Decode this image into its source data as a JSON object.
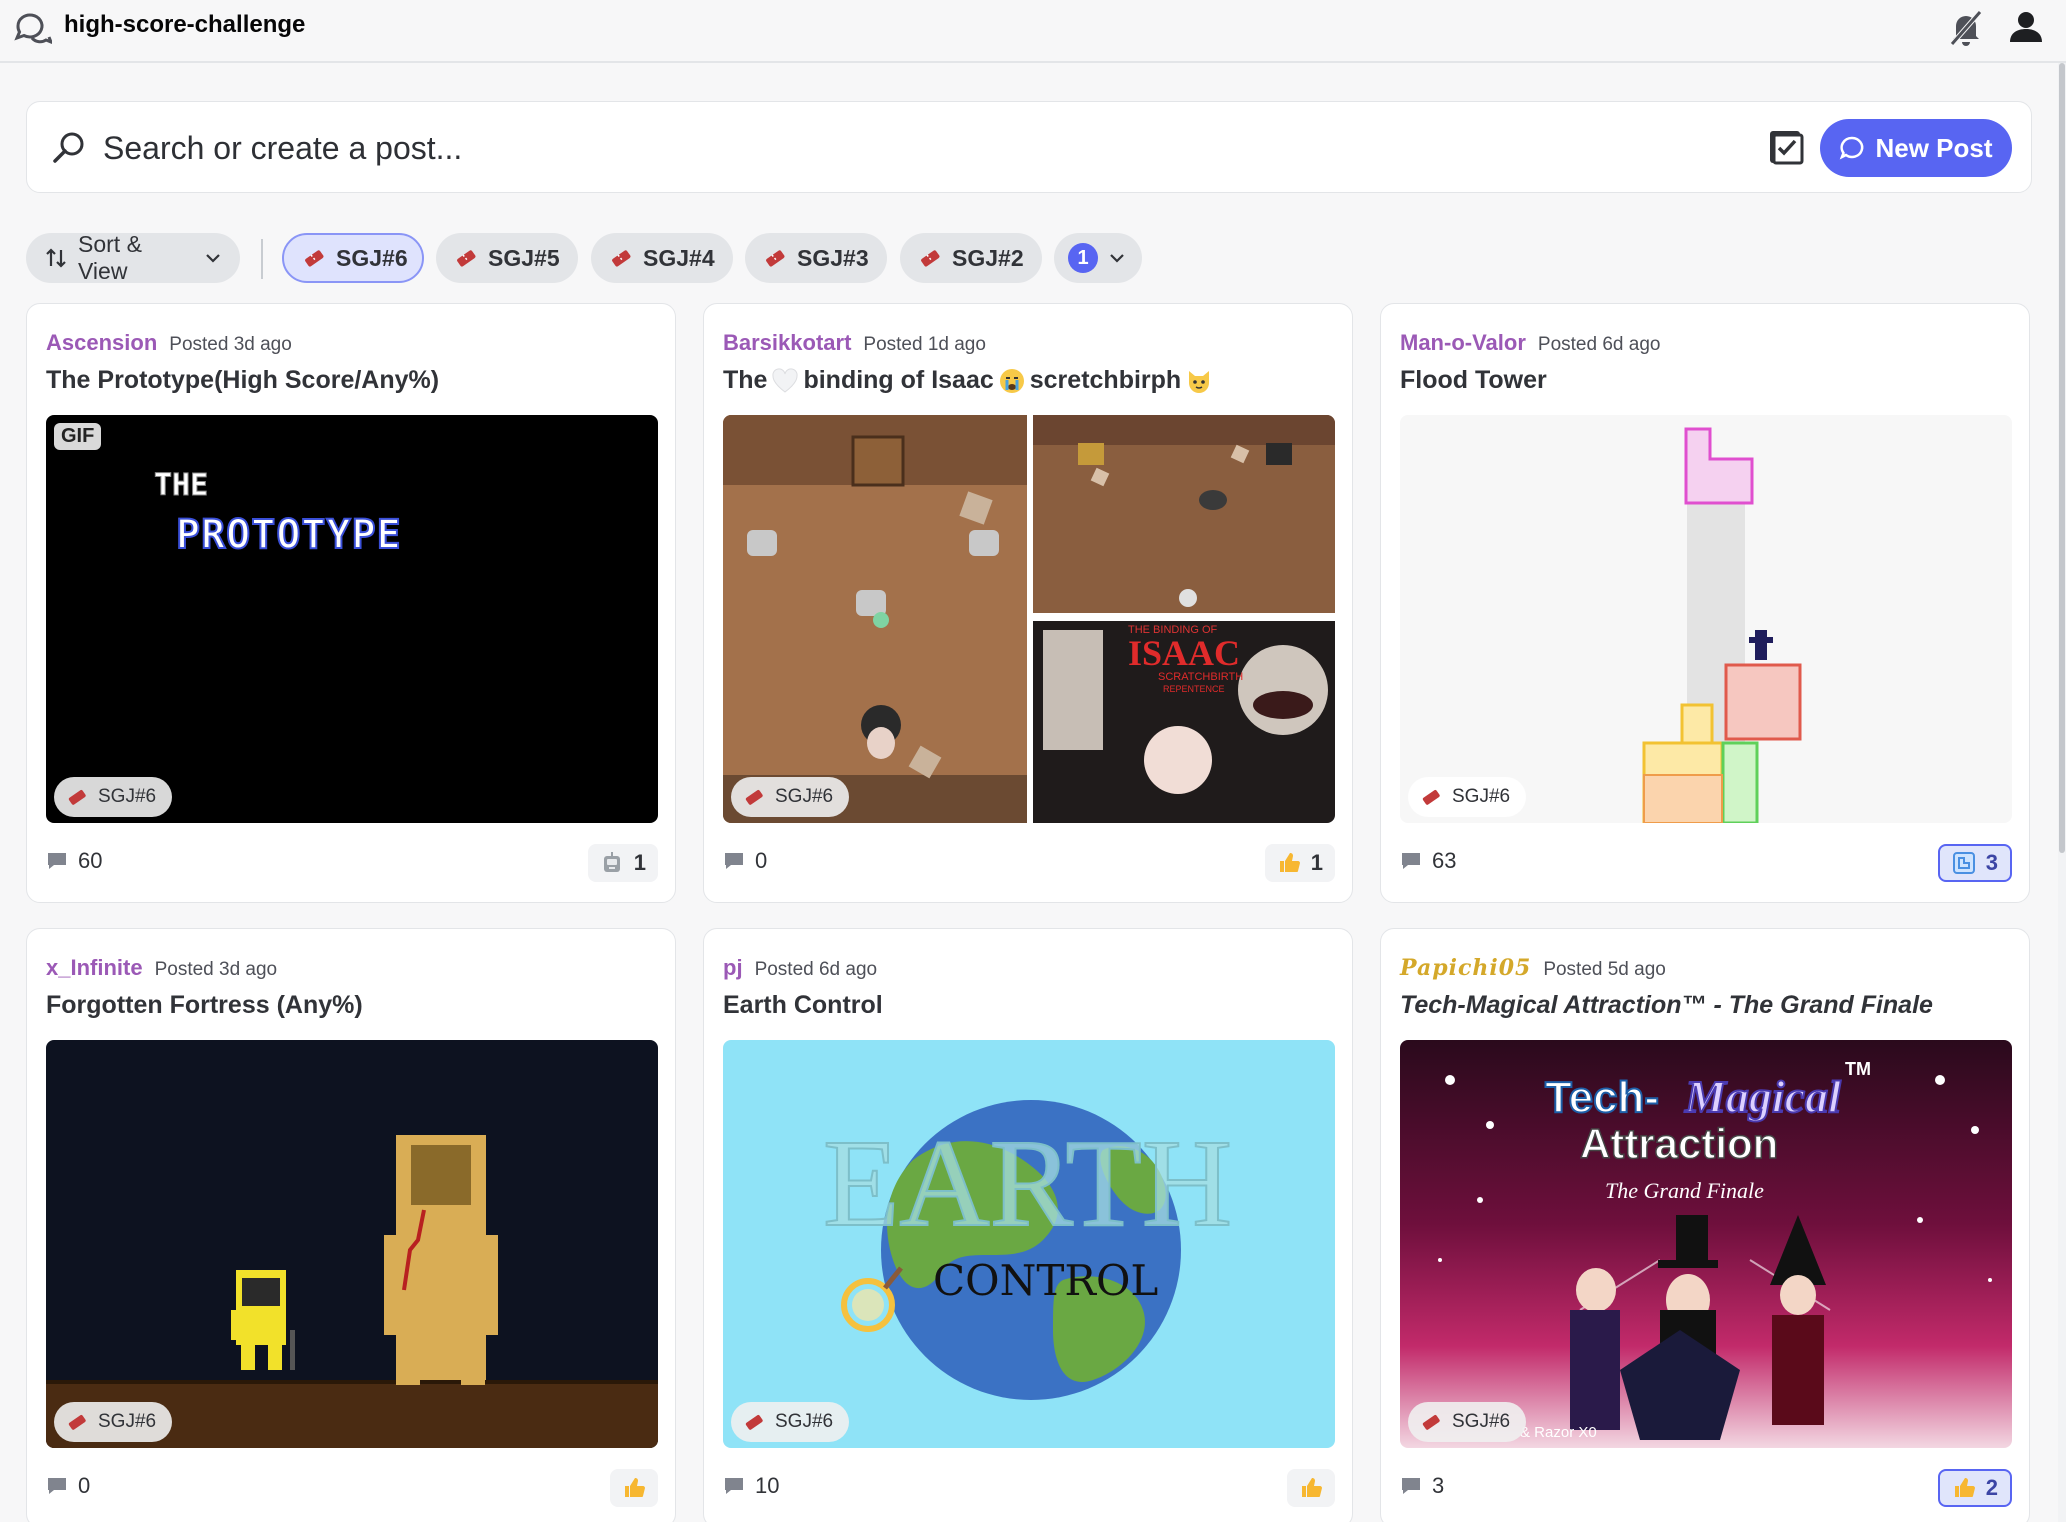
{
  "header": {
    "channel_name": "high-score-challenge"
  },
  "search": {
    "placeholder": "Search or create a post...",
    "new_post_label": "New Post"
  },
  "filters": {
    "sort_label": "Sort & View",
    "tags": [
      "SGJ#6",
      "SGJ#5",
      "SGJ#4",
      "SGJ#3",
      "SGJ#2"
    ],
    "active_tag": "SGJ#6",
    "more_count": "1"
  },
  "colors": {
    "accent": "#5865f2",
    "author": "#9b59b6",
    "author_gold": "#d4a82a"
  },
  "posts": [
    {
      "author": "Ascension",
      "posted": "Posted 3d ago",
      "title": "The Prototype(High Score/Any%)",
      "tag": "SGJ#6",
      "comments": "60",
      "reaction_count": "1",
      "reaction_icon": "robot-icon",
      "media_badge": "GIF",
      "media_text_1": "THE",
      "media_text_2": "PROTOTYPE"
    },
    {
      "author": "Barsikkotart",
      "posted": "Posted 1d ago",
      "title_parts": [
        "The",
        "binding of Isaac",
        "scretchbirph"
      ],
      "tag": "SGJ#6",
      "comments": "0",
      "reaction_count": "1",
      "reaction_icon": "thumbs-up-icon",
      "media_text_1": "THE BINDING OF",
      "media_text_2": "ISAAC",
      "media_text_3": "SCRATCHBIRTH",
      "media_text_4": "REPENTENCE"
    },
    {
      "author": "Man-o-Valor",
      "posted": "Posted 6d ago",
      "title": "Flood Tower",
      "tag": "SGJ#6",
      "comments": "63",
      "reaction_count": "3",
      "reaction_icon": "tetris-icon"
    },
    {
      "author": "x_Infinite",
      "posted": "Posted 3d ago",
      "title": "Forgotten Fortress (Any%)",
      "tag": "SGJ#6",
      "comments": "0",
      "reaction_icon": "thumbs-up-icon"
    },
    {
      "author": "pj",
      "posted": "Posted 6d ago",
      "title": "Earth Control",
      "tag": "SGJ#6",
      "comments": "10",
      "reaction_icon": "thumbs-up-icon",
      "media_text_1": "EARTH",
      "media_text_2": "CONTROL"
    },
    {
      "author": "Papichi05",
      "posted": "Posted 5d ago",
      "title": "Tech-Magical Attraction™ - The Grand Finale",
      "tag": "SGJ#6",
      "comments": "3",
      "reaction_count": "2",
      "reaction_icon": "thumbs-up-icon",
      "media_text_1": "Tech-",
      "media_text_2": "Magical",
      "media_text_3": "Attraction",
      "media_text_4": "The Grand Finale",
      "media_text_5": "TM",
      "media_text_6": "& Razor X0"
    }
  ]
}
